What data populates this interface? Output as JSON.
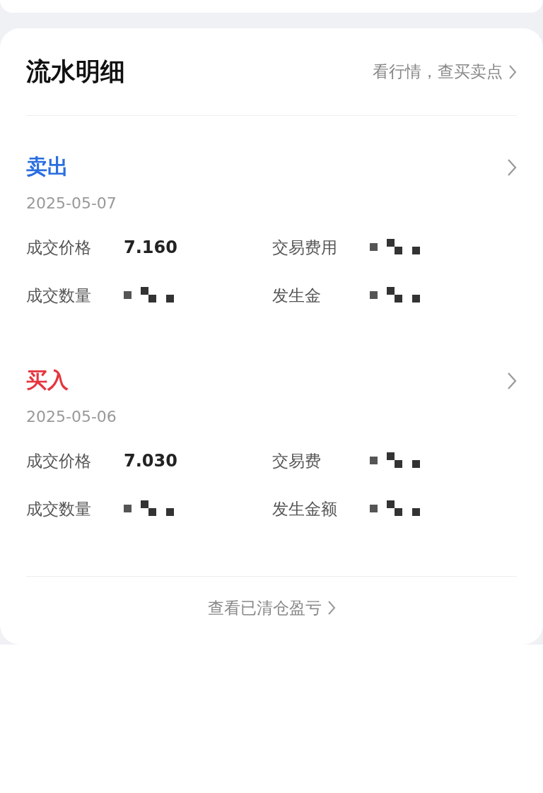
{
  "header": {
    "title": "流水明细",
    "link": "看行情，查买卖点"
  },
  "trades": [
    {
      "kind": "sell",
      "action": "卖出",
      "date": "2025-05-07",
      "fields": [
        {
          "kind": "value",
          "label": "成交价格",
          "value": "7.160"
        },
        {
          "kind": "redacted",
          "label": "交易费用"
        },
        {
          "kind": "redacted",
          "label": "成交数量"
        },
        {
          "kind": "redacted",
          "label": "发生金"
        }
      ]
    },
    {
      "kind": "buy",
      "action": "买入",
      "date": "2025-05-06",
      "fields": [
        {
          "kind": "value",
          "label": "成交价格",
          "value": "7.030"
        },
        {
          "kind": "redacted",
          "label": "交易费"
        },
        {
          "kind": "redacted",
          "label": "成交数量"
        },
        {
          "kind": "redacted",
          "label": "发生金额"
        }
      ]
    }
  ],
  "footer": {
    "link": "查看已清仓盈亏"
  }
}
